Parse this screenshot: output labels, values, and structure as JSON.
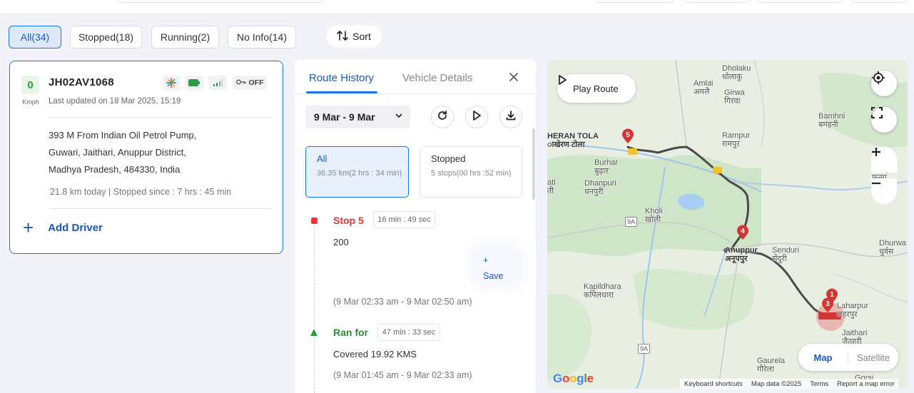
{
  "filters": {
    "all": "All(34)",
    "stopped": "Stopped(18)",
    "running": "Running(2)",
    "no_info": "No Info(14)",
    "sort": "Sort"
  },
  "vehicle": {
    "speed": "0",
    "speed_unit": "Kmph",
    "plate": "JH02AV1068",
    "last_updated": "Last updated on 18 Mar 2025, 15:19",
    "ignition": "OFF",
    "address_line1": "393 M From Indian Oil Petrol Pump,",
    "address_line2": "Guwari, Jaithari, Anuppur District,",
    "address_line3": "Madhya Pradesh, 484330, India",
    "today_summary": "21.8 km today | Stopped since : 7 hrs : 45 min",
    "add_driver": "Add Driver"
  },
  "panel": {
    "tab_route_history": "Route History",
    "tab_vehicle_details": "Vehicle Details",
    "date_range": "9 Mar - 9 Mar",
    "filter_all_title": "All",
    "filter_all_sub": "36.35 km(2 hrs : 34 min)",
    "filter_stopped_title": "Stopped",
    "filter_stopped_sub": "5 stops(00 hrs :52 min)",
    "events": [
      {
        "title": "Stop 5",
        "duration": "16 min : 49 sec",
        "text": "200",
        "range": "(9 Mar 02:33 am - 9 Mar 02:50 am)"
      },
      {
        "title": "Ran for",
        "duration": "47 min : 33 sec",
        "text": "Covered 19.92 KMS",
        "range": "(9 Mar 01:45 am - 9 Mar 02:33 am)"
      }
    ],
    "save_plus": "+",
    "save_label": "Save"
  },
  "map": {
    "play_route": "Play Route",
    "type_map": "Map",
    "type_satellite": "Satellite",
    "google": "Google",
    "attrib_shortcuts": "Keyboard shortcuts",
    "attrib_data": "Map data ©2025",
    "attrib_terms": "Terms",
    "attrib_report": "Report a map error",
    "pins": [
      "5",
      "4",
      "1",
      "3"
    ],
    "labels": {
      "dholaku": "Dholaku\nधोलाकु",
      "amlai": "Amlai\nअमलै",
      "girwa": "Girwa\nगिरवा",
      "bamhni": "Bamhni\nबमहनी",
      "rampur": "Rampur\nरामपुर",
      "heran_tola": "HERAN TOLA\nाखेरण टोला",
      "burhar": "Burhar\nबुढ़ार",
      "dhanpuri": "Dhanpuri\nधनपुरी",
      "ati": "ati\nती",
      "fung": "Fung\nफुनग",
      "kholi": "Kholi\nखोली",
      "dhurwa": "Dhurwa\nधुर्वस",
      "anuppur": "Anuppur\nअनूपपुर",
      "senduri": "Senduri\nसेंदुरी",
      "kapildhara": "Kapildhara\nकपिलधारा",
      "laharpur": "Laharpur\nलहरपुर",
      "jaithari": "Jaithari\nजैतहरी",
      "gaurela": "Gaurela\nगौरेला",
      "gorsi": "Gorsi",
      "road_9a_1": "9A",
      "road_9a_2": "9A"
    }
  }
}
